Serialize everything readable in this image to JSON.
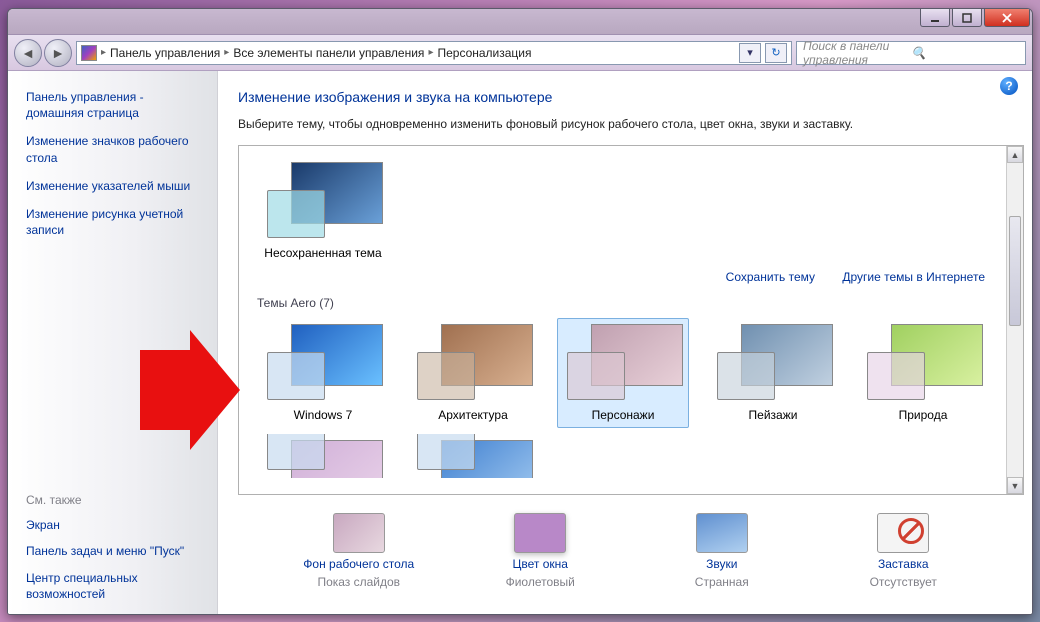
{
  "breadcrumb": {
    "part1": "Панель управления",
    "part2": "Все элементы панели управления",
    "part3": "Персонализация"
  },
  "search": {
    "placeholder": "Поиск в панели управления"
  },
  "sidebar": {
    "links": [
      "Панель управления - домашняя страница",
      "Изменение значков рабочего стола",
      "Изменение указателей мыши",
      "Изменение рисунка учетной записи"
    ],
    "see_also_header": "См. также",
    "see_also": [
      "Экран",
      "Панель задач и меню \"Пуск\"",
      "Центр специальных возможностей"
    ]
  },
  "main": {
    "title": "Изменение изображения и звука на компьютере",
    "subtitle": "Выберите тему, чтобы одновременно изменить фоновый рисунок рабочего стола, цвет окна, звуки и заставку.",
    "unsaved_theme": "Несохраненная тема",
    "save_theme": "Сохранить тему",
    "more_themes": "Другие темы в Интернете",
    "aero_header": "Темы Aero (7)",
    "aero": [
      "Windows 7",
      "Архитектура",
      "Персонажи",
      "Пейзажи",
      "Природа"
    ]
  },
  "settings": [
    {
      "title": "Фон рабочего стола",
      "sub": "Показ слайдов"
    },
    {
      "title": "Цвет окна",
      "sub": "Фиолетовый"
    },
    {
      "title": "Звуки",
      "sub": "Странная"
    },
    {
      "title": "Заставка",
      "sub": "Отсутствует"
    }
  ]
}
